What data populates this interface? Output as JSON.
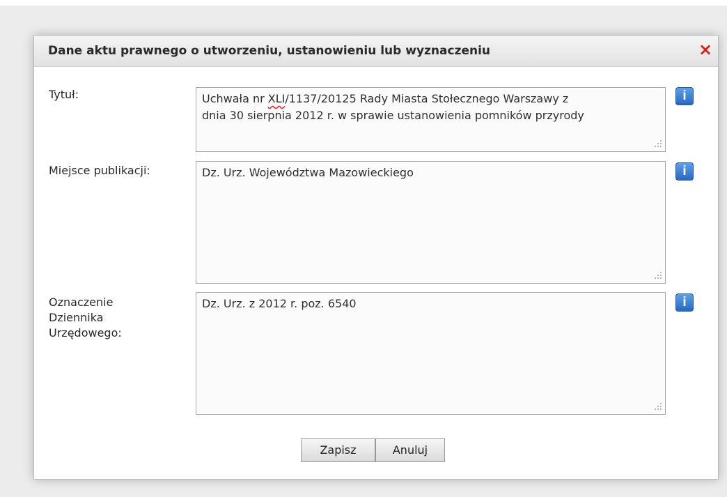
{
  "dialog": {
    "title": "Dane aktu prawnego o utworzeniu, ustanowieniu lub wyznaczeniu",
    "close_icon": "×"
  },
  "form": {
    "tytul": {
      "label": "Tytuł:",
      "value_line1_prefix": "Uchwała nr ",
      "value_line1_misspelled": "XLI",
      "value_line1_suffix": "/1137/20125 Rady Miasta Stołecznego Warszawy z",
      "value_line2": "dnia 30 sierpnia 2012 r. w sprawie ustanowienia pomników przyrody",
      "info_icon": "i"
    },
    "miejsce_publikacji": {
      "label": "Miejsce publikacji:",
      "value": "Dz. Urz. Województwa Mazowieckiego",
      "info_icon": "i"
    },
    "oznaczenie_dziennika": {
      "label_line1": "Oznaczenie",
      "label_line2": "Dziennika",
      "label_line3": "Urzędowego:",
      "value": "Dz. Urz. z 2012 r. poz. 6540",
      "info_icon": "i"
    }
  },
  "buttons": {
    "save": "Zapisz",
    "cancel": "Anuluj"
  },
  "colors": {
    "close": "#d61f1f",
    "info": "#2a67c0",
    "spellcheck": "#d63030"
  }
}
